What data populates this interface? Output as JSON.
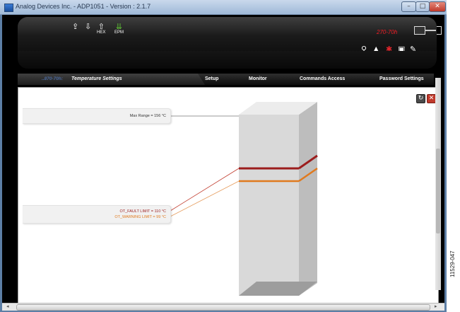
{
  "window": {
    "title": "Analog Devices Inc. - ADP1051 - Version : 2.1.7",
    "min_glyph": "–",
    "max_glyph": "□",
    "close_glyph": "✕"
  },
  "toolbar": {
    "items": [
      {
        "icon": "upload-icon",
        "glyph": "⇪",
        "label": ""
      },
      {
        "icon": "download-icon",
        "glyph": "⇩",
        "label": ""
      },
      {
        "icon": "hex-icon",
        "glyph": "⇧",
        "label": "HEX"
      },
      {
        "icon": "eprom-icon",
        "glyph": "⇊",
        "label": "EPM"
      }
    ],
    "device_label": "270-70h",
    "right_icons": [
      {
        "icon": "search-icon",
        "glyph": "⚲"
      },
      {
        "icon": "waveform-icon",
        "glyph": "▲"
      },
      {
        "icon": "settings-icon",
        "glyph": "✱"
      },
      {
        "icon": "lock-icon",
        "glyph": "▣"
      },
      {
        "icon": "pen-icon",
        "glyph": "✎"
      }
    ]
  },
  "nav": {
    "prefix": "..870-70h:",
    "items": [
      "Temperature Settings",
      "Setup",
      "Monitor",
      "Commands Access",
      "Password Settings"
    ]
  },
  "panel": {
    "refresh_glyph": "↻",
    "close_glyph": "✕",
    "max_range_text": "Max Range = 156 °C",
    "fault_text": "OT_FAULT LIMIT = 110 °C",
    "warning_text": "OT_WARNING LIMIT = 99 °C",
    "values": {
      "max_range": 156,
      "fault_limit": 110,
      "warning_limit": 99
    },
    "colors": {
      "fault": "#9c1d1d",
      "warning": "#e07a1f",
      "max": "#8c8c8c"
    }
  },
  "figure_id": "11529-047"
}
